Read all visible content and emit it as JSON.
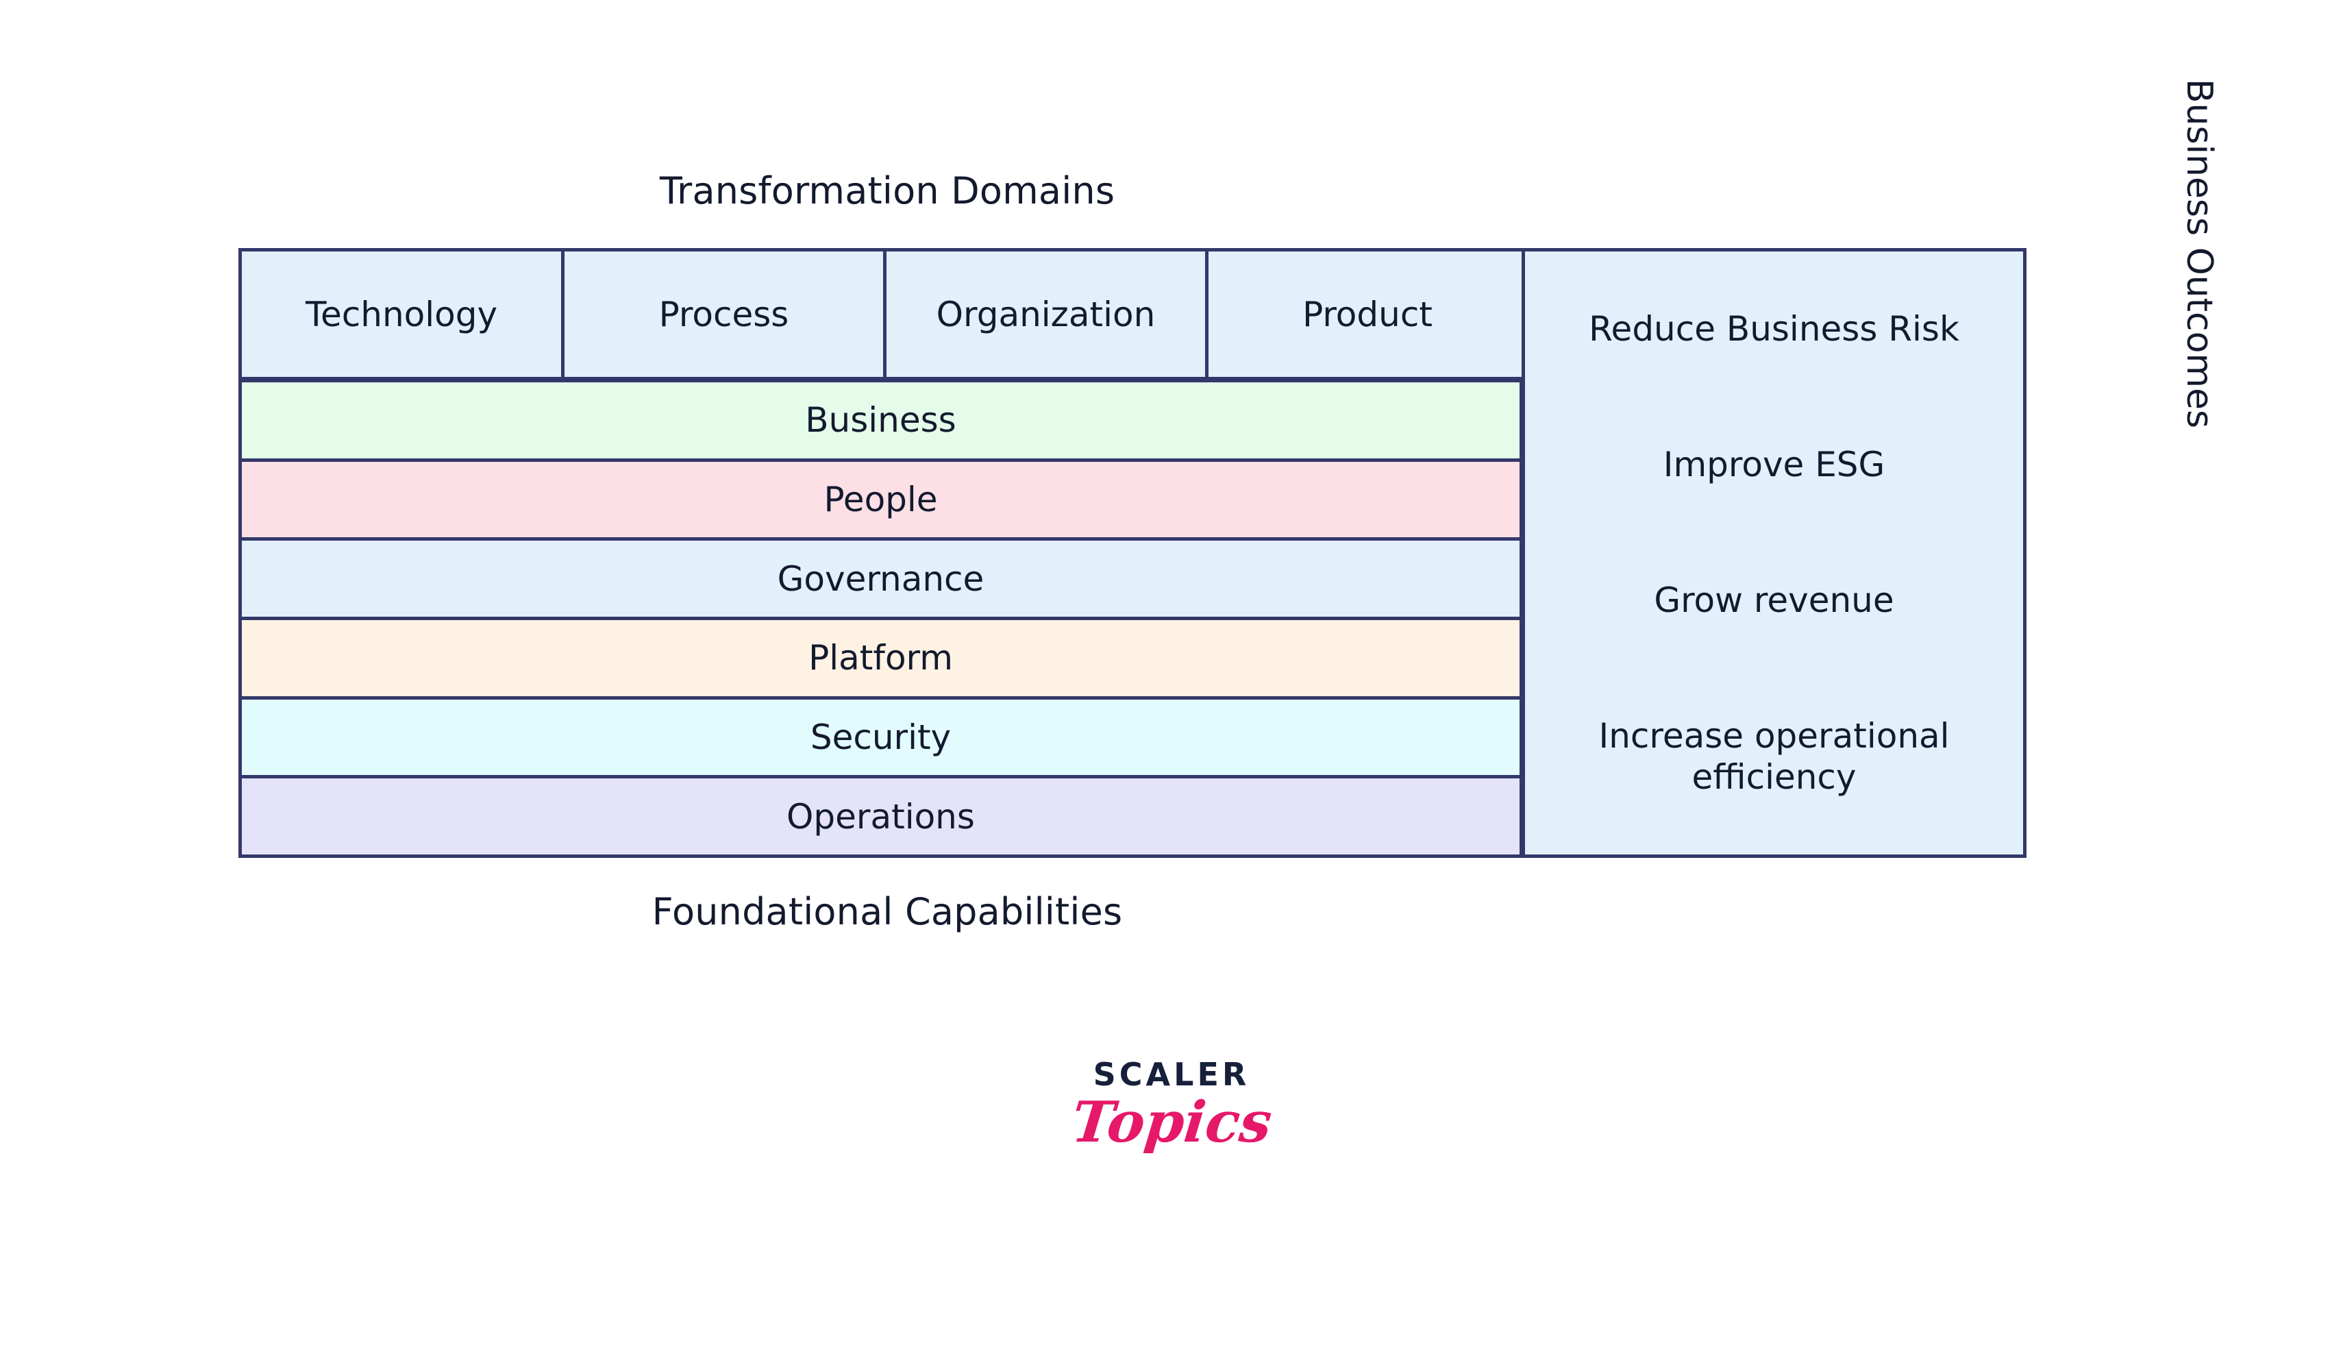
{
  "captions": {
    "top": "Transformation Domains",
    "bottom": "Foundational Capabilities",
    "right_axis": "Business Outcomes"
  },
  "chart_data": {
    "type": "table",
    "title": "Transformation Domains",
    "subtitle": "Foundational Capabilities",
    "columns_label": "Transformation Domains",
    "rows_label": "Foundational Capabilities",
    "series_label": "Business Outcomes",
    "categories": [
      "Technology",
      "Process",
      "Organization",
      "Product"
    ],
    "rows": [
      "Business",
      "People",
      "Governance",
      "Platform",
      "Security",
      "Operations"
    ],
    "outcomes": [
      "Reduce Business Risk",
      "Improve ESG",
      "Grow revenue",
      "Increase operational efficiency"
    ],
    "grid": true,
    "legend": "none"
  },
  "matrix": {
    "domains": [
      {
        "label": "Technology",
        "fill": "#E2F0FC"
      },
      {
        "label": "Process",
        "fill": "#E2F0FC"
      },
      {
        "label": "Organization",
        "fill": "#E2F0FC"
      },
      {
        "label": "Product",
        "fill": "#E2F0FC"
      }
    ],
    "capabilities": [
      {
        "label": "Business",
        "fill": "#E4FCE9"
      },
      {
        "label": "People",
        "fill": "#FCE0E6"
      },
      {
        "label": "Governance",
        "fill": "#E2F0FC"
      },
      {
        "label": "Platform",
        "fill": "#FDF2E3"
      },
      {
        "label": "Security",
        "fill": "#E2FCFD"
      },
      {
        "label": "Operations",
        "fill": "#E5E3FA"
      }
    ],
    "outcomes": [
      {
        "label": "Reduce Business Risk"
      },
      {
        "label": "Improve ESG"
      },
      {
        "label": "Grow revenue"
      },
      {
        "label": "Increase operational efficiency"
      }
    ]
  },
  "colors": {
    "border": "#33386B",
    "text": "#131A2E",
    "panel_fill": "#E2F0FC",
    "logo_dark": "#17203A",
    "logo_pink": "#E6186A",
    "background": "#FFFFFF"
  },
  "logo": {
    "word_mark": "SCALER",
    "script_mark": "Topics"
  }
}
